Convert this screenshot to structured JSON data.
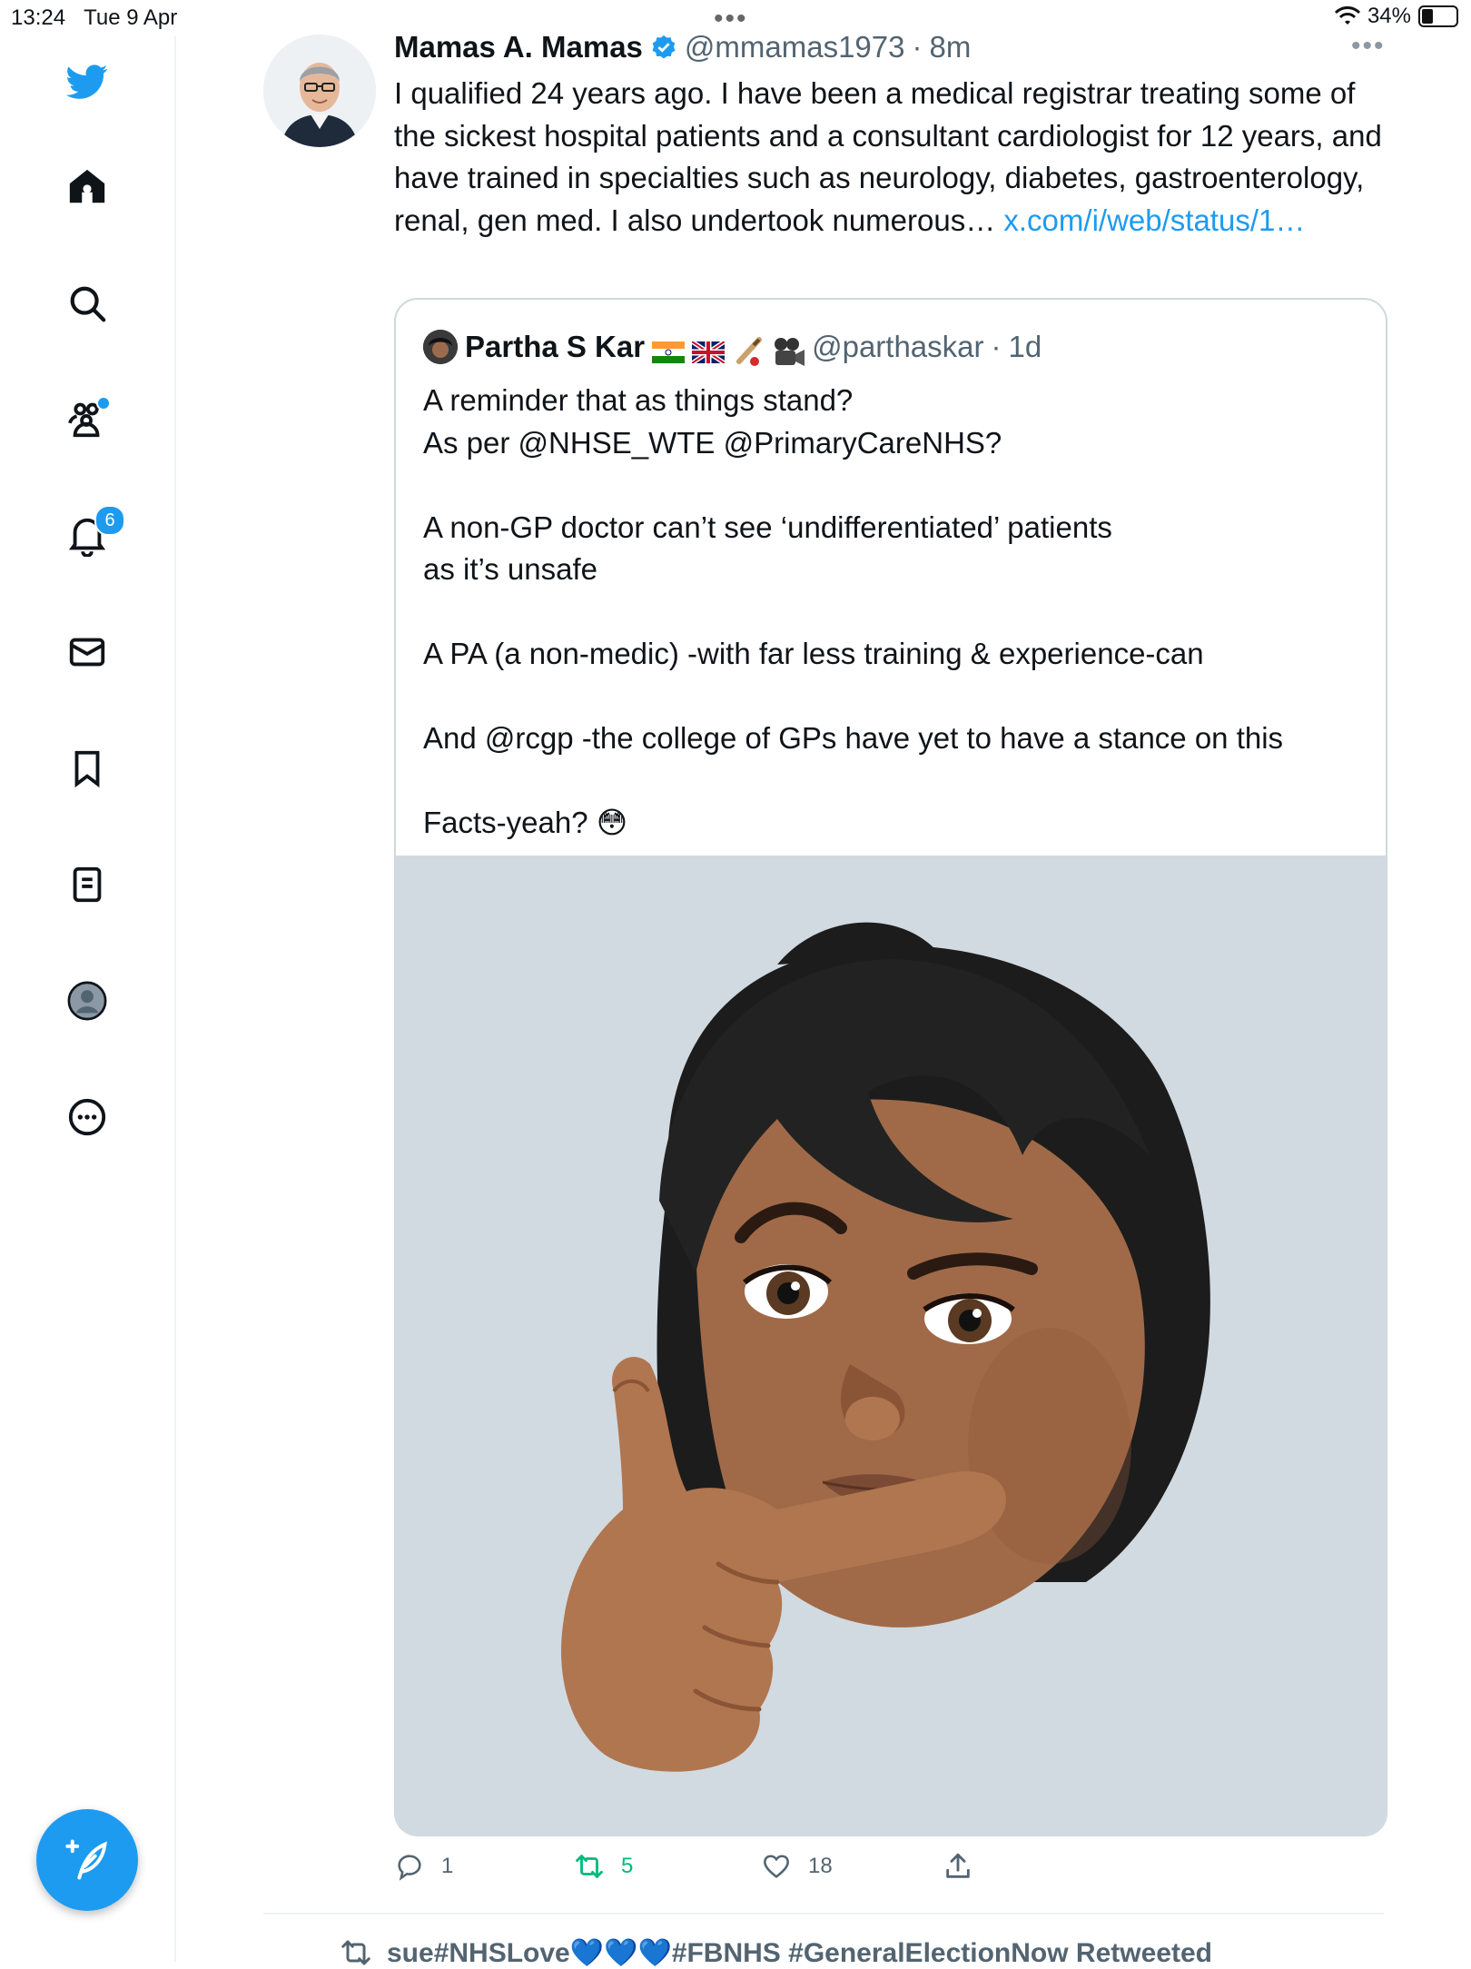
{
  "status_bar": {
    "time": "13:24",
    "date": "Tue 9 Apr",
    "battery": "34%",
    "battery_level": 0.34
  },
  "nav": {
    "items": [
      "logo",
      "home",
      "search",
      "communities",
      "notifications",
      "messages",
      "bookmarks",
      "lists",
      "profile",
      "more"
    ],
    "notifications_count": "6"
  },
  "tweet": {
    "author_name": "Mamas A. Mamas",
    "verified": true,
    "handle": "@mmamas1973",
    "separator": "·",
    "time": "8m",
    "text": "I qualified 24 years ago.  I have been a medical registrar treating some of the sickest hospital patients and a consultant cardiologist for 12 years, and have trained in specialties such as neurology, diabetes, gastroenterology, renal, gen med. I also undertook numerous… ",
    "link": "x.com/i/web/status/1…",
    "replies": "1",
    "retweets": "5",
    "likes": "18"
  },
  "quote": {
    "author_name": "Partha S Kar",
    "handle": "@parthaskar",
    "separator": "·",
    "time": "1d",
    "lines": [
      "A reminder that as things stand?",
      "As per @NHSE_WTE @PrimaryCareNHS?",
      "",
      "A non-GP doctor can’t see ‘undifferentiated’ patients",
      "as it’s unsafe",
      "",
      "A PA (a non-medic) -with far less training & experience-can",
      "",
      "And @rcgp -the college of GPs have yet to have a stance on this",
      "",
      "Facts-yeah? 😳"
    ]
  },
  "next_tweet": {
    "context": "sue#NHSLove💙💙💙#FBNHS #GeneralElectionNow Retweeted"
  },
  "colors": {
    "accent": "#1d9bf0",
    "retweet_green": "#00ba7c",
    "secondary_text": "#536471",
    "image_bg": "#d1dae1"
  }
}
